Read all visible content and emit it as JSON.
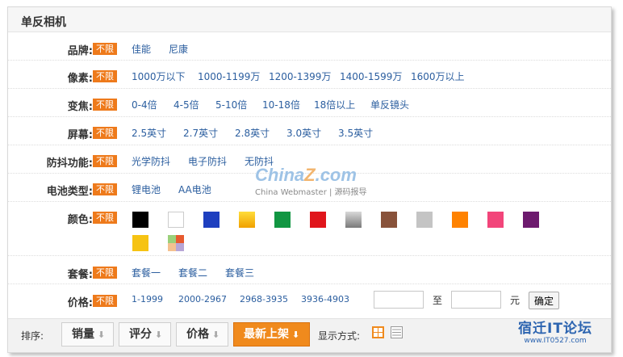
{
  "title": "单反相机",
  "unlimited": "不限",
  "filters": {
    "brand": {
      "label": "品牌:",
      "options": [
        "佳能",
        "尼康"
      ]
    },
    "pixels": {
      "label": "像素:",
      "options": [
        "1000万以下",
        "1000-1199万",
        "1200-1399万",
        "1400-1599万",
        "1600万以上"
      ]
    },
    "zoom": {
      "label": "变焦:",
      "options": [
        "0-4倍",
        "4-5倍",
        "5-10倍",
        "10-18倍",
        "18倍以上",
        "单反镜头"
      ]
    },
    "screen": {
      "label": "屏幕:",
      "options": [
        "2.5英寸",
        "2.7英寸",
        "2.8英寸",
        "3.0英寸",
        "3.5英寸"
      ]
    },
    "stabilization": {
      "label": "防抖功能:",
      "options": [
        "光学防抖",
        "电子防抖",
        "无防抖"
      ]
    },
    "battery": {
      "label": "电池类型:",
      "options": [
        "锂电池",
        "AA电池"
      ]
    },
    "color": {
      "label": "颜色:",
      "swatches": [
        "#000000",
        "#ffffff",
        "#1e3fbf",
        "#f3c016",
        "#119642",
        "#e0151b",
        "#9a9a9a",
        "#88523a",
        "#c4c4c4",
        "#ff8200",
        "#f2457a",
        "#6d1a6e",
        "#f6c313",
        "multicolor"
      ]
    },
    "package": {
      "label": "套餐:",
      "options": [
        "套餐一",
        "套餐二",
        "套餐三"
      ]
    },
    "price": {
      "label": "价格:",
      "options": [
        "1-1999",
        "2000-2967",
        "2968-3935",
        "3936-4903"
      ],
      "to": "至",
      "unit": "元",
      "confirm": "确定",
      "min_value": "",
      "max_value": ""
    }
  },
  "sort": {
    "label": "排序:",
    "buttons": [
      "销量",
      "评分",
      "价格",
      "最新上架"
    ],
    "active": "最新上架",
    "display_label": "显示方式:"
  },
  "watermark": {
    "logo": "China",
    "logo_z": "Z",
    "logo_com": ".com",
    "tagline_left": "China Webmaster",
    "tagline_right": "源码报导"
  },
  "brand_footer": {
    "name": "宿迁IT论坛",
    "url": "www.IT0527.com"
  },
  "colors": {
    "accent": "#ee7a1b",
    "link": "#2b5e9f"
  }
}
